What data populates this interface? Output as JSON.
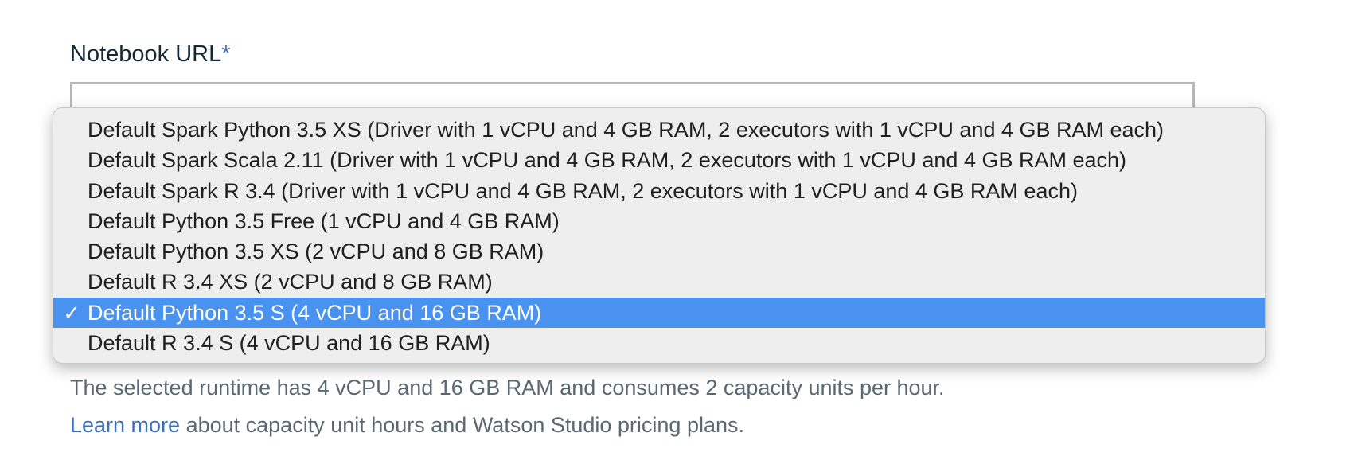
{
  "notebook_url": {
    "label": "Notebook URL",
    "required_mark": "*",
    "value": ""
  },
  "runtime_dropdown": {
    "options": [
      {
        "label": "Default Spark Python 3.5 XS (Driver with 1 vCPU and 4 GB RAM, 2 executors with 1 vCPU and 4 GB RAM each)",
        "selected": false
      },
      {
        "label": "Default Spark Scala 2.11 (Driver with 1 vCPU and 4 GB RAM, 2 executors with 1 vCPU and 4 GB RAM each)",
        "selected": false
      },
      {
        "label": "Default Spark R 3.4 (Driver with 1 vCPU and 4 GB RAM, 2 executors with 1 vCPU and 4 GB RAM each)",
        "selected": false
      },
      {
        "label": "Default Python 3.5 Free (1 vCPU and 4 GB RAM)",
        "selected": false
      },
      {
        "label": "Default Python 3.5 XS (2 vCPU and 8 GB RAM)",
        "selected": false
      },
      {
        "label": "Default R 3.4 XS (2 vCPU and 8 GB RAM)",
        "selected": false
      },
      {
        "label": "Default Python 3.5 S (4 vCPU and 16 GB RAM)",
        "selected": true
      },
      {
        "label": "Default R 3.4 S (4 vCPU and 16 GB RAM)",
        "selected": false
      }
    ],
    "check_glyph": "✓",
    "check_icon": "checkmark-icon",
    "selected_color": "#4a92ef"
  },
  "helper": {
    "runtime_description": "The selected runtime has 4 vCPU and 16 GB RAM and consumes 2 capacity units per hour.",
    "learn_more_link": "Learn more",
    "learn_more_suffix": " about capacity unit hours and Watson Studio pricing plans."
  },
  "colors": {
    "link": "#3d70b2",
    "label_text": "#152935",
    "helper_text": "#5a6872"
  }
}
